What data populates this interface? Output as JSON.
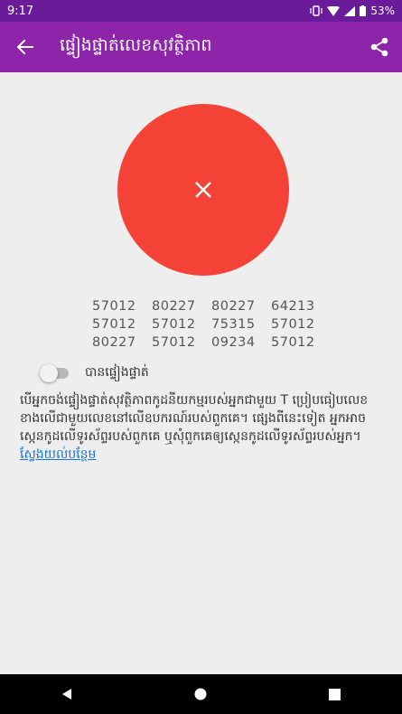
{
  "status_bar": {
    "time": "9:17",
    "battery": "53%"
  },
  "app_bar": {
    "title": "ផ្ទៀងផ្ទាត់លេខសុវត្ថិភាព"
  },
  "verification": {
    "status": "not-verified",
    "color": "#f44336",
    "safety_number_rows": [
      [
        "57012",
        "80227",
        "80227",
        "64213"
      ],
      [
        "57012",
        "57012",
        "75315",
        "57012"
      ],
      [
        "80227",
        "57012",
        "09234",
        "57012"
      ]
    ],
    "toggle_label": "បានផ្ទៀងផ្ទាត់",
    "toggle_on": false
  },
  "description": {
    "text": "បើអ្នកចង់ផ្ទៀងផ្ទាត់សុវត្ថិភាពកូដនីយកម្មរបស់អ្នកជាមួយ T ប្រៀបធៀបលេខខាងលើជាមួយលេខនៅលើឧបករណ៍របស់ពួកគេ។ ផ្សេងពីនេះទៀត អ្នកអាចស្កេនកូដលើទូរស័ព្ទរបស់ពួកគេ ឬសុំពួកគេឲ្យស្កេនកូដលើទូរស័ព្ទរបស់អ្នក។ ",
    "link": "ស្វែងយល់បន្ថែម"
  }
}
